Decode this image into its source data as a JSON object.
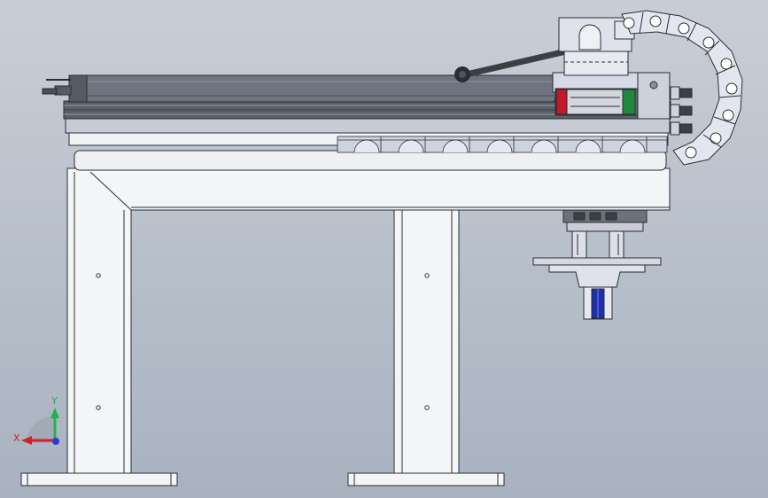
{
  "viewport": {
    "background_top": "#c9ced6",
    "background_bottom": "#a9b2c0"
  },
  "triad": {
    "x_label": "X",
    "y_label": "Y",
    "x_color": "#d0202a",
    "y_color": "#22b24c",
    "z_color": "#2a3bd6"
  },
  "model": {
    "frame_color": "#f4f5f7",
    "outline_color": "#2a2d33",
    "rail_color": "#5b6069",
    "cylinder_color": "#6f7580",
    "carriage_color": "#d7dae6",
    "chain_color": "#e3e6ef",
    "guide_block_accent": "#c2182b",
    "guide_block_accent2": "#1f8a3b",
    "gripper_accent": "#1f2fa8"
  }
}
